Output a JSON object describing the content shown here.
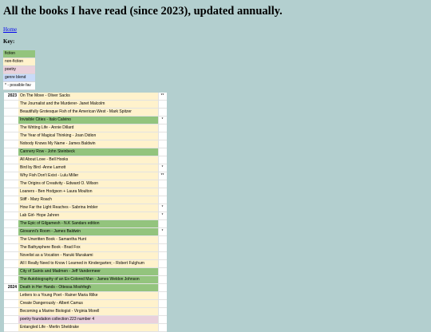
{
  "page": {
    "heading": "All the books I have read (since 2023), updated annually.",
    "home_link": "Home",
    "key_label": "Key:"
  },
  "colors": {
    "fiction": "#93c47d",
    "non-fiction": "#fff2cc",
    "poetry": "#ead1dc",
    "genre blend": "#c9daf8",
    "background": "#b3cfcf"
  },
  "key": [
    {
      "label": "fiction",
      "type": "fiction"
    },
    {
      "label": "non-fiction",
      "type": "nonfiction"
    },
    {
      "label": "poetry",
      "type": "poetry"
    },
    {
      "label": "genre blend",
      "type": "genre"
    },
    {
      "label": "* - possible fav",
      "type": "plain"
    }
  ],
  "years": [
    {
      "year": "2023",
      "books": [
        {
          "title": "On The Move - Oliver Sacks",
          "type": "nonfiction",
          "fav": "**"
        },
        {
          "title": "The Journalist and the Murderer- Janet Malcolm",
          "type": "nonfiction",
          "fav": ""
        },
        {
          "title": "Beautifully Grotesque Fish of the American West - Mark Spitzer",
          "type": "nonfiction",
          "fav": ""
        },
        {
          "title": "Invisible Cities - Italo Calvino",
          "type": "fiction",
          "fav": "*"
        },
        {
          "title": "The Writing Life - Annie Dillard",
          "type": "nonfiction",
          "fav": ""
        },
        {
          "title": "The Year of Magical Thinking - Joan Didion",
          "type": "nonfiction",
          "fav": ""
        },
        {
          "title": "Nobody Knows My Name - James Baldwin",
          "type": "nonfiction",
          "fav": ""
        },
        {
          "title": "Cannery Row - John Steinbeck",
          "type": "fiction",
          "fav": ""
        },
        {
          "title": "All About Love - Bell Hooks",
          "type": "nonfiction",
          "fav": ""
        },
        {
          "title": "Bird by Bird -Anne Lamott",
          "type": "nonfiction",
          "fav": "*"
        },
        {
          "title": "Why Fish Don't Exist - Lulu Miller",
          "type": "nonfiction",
          "fav": "**"
        },
        {
          "title": "The Origins of Creativity - Edward O. Wilson",
          "type": "nonfiction",
          "fav": ""
        },
        {
          "title": "Loaners - Ben Hodgson + Laura Moulton",
          "type": "nonfiction",
          "fav": ""
        },
        {
          "title": "Stiff - Mary Roach",
          "type": "nonfiction",
          "fav": ""
        },
        {
          "title": "How Far the Light Reaches - Sabrina Imbler",
          "type": "nonfiction",
          "fav": "*"
        },
        {
          "title": "Lab Girl- Hope Jahren",
          "type": "nonfiction",
          "fav": "*"
        },
        {
          "title": "The Epic of Gilgamesh - N.K Sandars edition",
          "type": "fiction",
          "fav": ""
        },
        {
          "title": "Giovanni's Room - James Baldwin",
          "type": "fiction",
          "fav": "*"
        },
        {
          "title": "The Unwritten Book - Samantha Hunt",
          "type": "nonfiction",
          "fav": ""
        },
        {
          "title": "The Bathysphere Book - Brad Fox",
          "type": "nonfiction",
          "fav": ""
        },
        {
          "title": "Novelist as a Vocation - Haruki Murakami",
          "type": "nonfiction",
          "fav": ""
        },
        {
          "title": "All I Really Need to Know I Learned in Kindergarten; - Robert Fulghum",
          "type": "nonfiction",
          "fav": ""
        },
        {
          "title": "City of Saints and Madmen - Jeff Vandermeer",
          "type": "fiction",
          "fav": ""
        },
        {
          "title": "The Autobiography of an Ex-Colored Man - James Weldon Johnson",
          "type": "fiction",
          "fav": ""
        },
        {
          "title": "Drinking Coffee Elsewhere - ZZ Packer",
          "type": "fiction",
          "fav": ""
        },
        {
          "title": "Homesick for Another World - Ottessa Moshfegh",
          "type": "fiction",
          "fav": ""
        }
      ]
    },
    {
      "year": "2024",
      "books": [
        {
          "title": "Death in Her Hands - Ottessa Moshfegh",
          "type": "fiction",
          "fav": ""
        },
        {
          "title": "Letters to a Young Poet - Rainer Maria Rilke",
          "type": "nonfiction",
          "fav": ""
        },
        {
          "title": "Create Dangerously - Albert Camus",
          "type": "nonfiction",
          "fav": ""
        },
        {
          "title": "Becoming a Marine Biologist - Virginia Morell",
          "type": "nonfiction",
          "fav": ""
        },
        {
          "title": "poetry foundation collection 223 number 4",
          "type": "poetry",
          "fav": ""
        },
        {
          "title": "Entangled Life - Merlin Sheldrake",
          "type": "nonfiction",
          "fav": ""
        }
      ]
    }
  ]
}
